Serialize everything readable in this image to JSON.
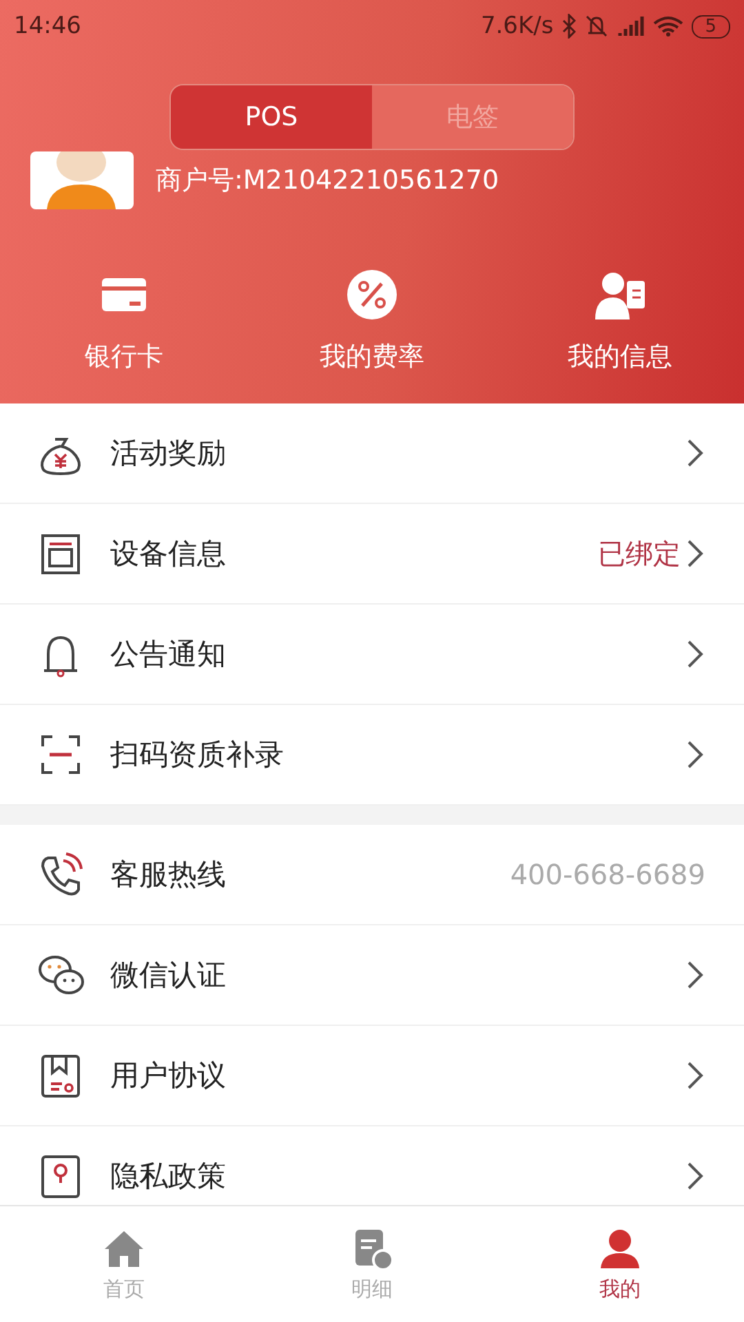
{
  "status_bar": {
    "time": "14:46",
    "speed": "7.6K/s",
    "battery": "5"
  },
  "segments": [
    {
      "label": "POS",
      "selected": true
    },
    {
      "label": "电签",
      "selected": false
    }
  ],
  "merchant": {
    "label": "商户号:M21042210561270"
  },
  "shortcuts": [
    {
      "label": "银行卡"
    },
    {
      "label": "我的费率"
    },
    {
      "label": "我的信息"
    }
  ],
  "menu_groups": [
    {
      "items": [
        {
          "label": "活动奖励",
          "chevron": true
        },
        {
          "label": "设备信息",
          "value": "已绑定",
          "chevron": true
        },
        {
          "label": "公告通知",
          "chevron": true
        },
        {
          "label": "扫码资质补录",
          "chevron": true
        }
      ]
    },
    {
      "items": [
        {
          "label": "客服热线",
          "value": "400-668-6689",
          "chevron": false
        },
        {
          "label": "微信认证",
          "chevron": true
        },
        {
          "label": "用户协议",
          "chevron": true
        },
        {
          "label": "隐私政策",
          "chevron": true
        }
      ]
    }
  ],
  "tab_bar": [
    {
      "label": "首页",
      "selected": false
    },
    {
      "label": "明细",
      "selected": false
    },
    {
      "label": "我的",
      "selected": true
    }
  ]
}
